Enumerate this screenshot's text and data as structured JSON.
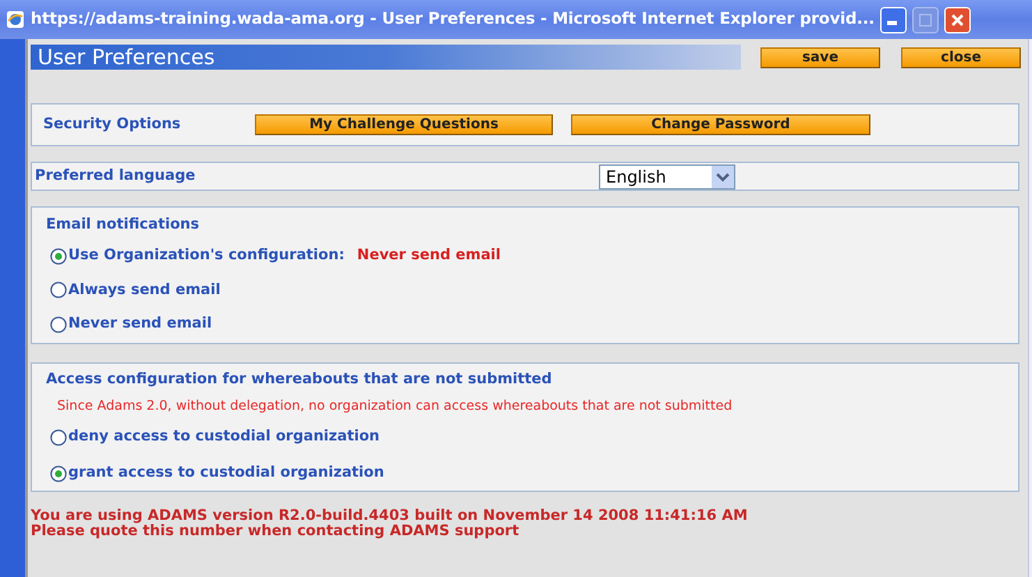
{
  "window": {
    "title": "https://adams-training.wada-ama.org - User Preferences - Microsoft Internet Explorer provid..."
  },
  "header": {
    "title": "User Preferences",
    "buttons": [
      "save",
      "close"
    ]
  },
  "security": {
    "label": "Security Options",
    "buttons": [
      "My Challenge Questions",
      "Change Password"
    ]
  },
  "language": {
    "label": "Preferred language",
    "value": "English"
  },
  "email": {
    "title": "Email notifications",
    "options": [
      {
        "label": "Use Organization's configuration:",
        "note": "Never send email",
        "selected": true
      },
      {
        "label": "Always send email",
        "selected": false
      },
      {
        "label": "Never send email",
        "selected": false
      }
    ]
  },
  "access": {
    "title": "Access configuration for whereabouts that are not submitted",
    "warning": "Since Adams 2.0, without delegation, no organization can access whereabouts that are not submitted",
    "options": [
      {
        "label": "deny access to custodial organization",
        "selected": false
      },
      {
        "label": "grant access to custodial organization",
        "selected": true
      }
    ]
  },
  "footer": [
    "You are using ADAMS version R2.0-build.4403 built on November 14 2008 11:41:16 AM",
    "Please quote this number when contacting ADAMS support"
  ]
}
